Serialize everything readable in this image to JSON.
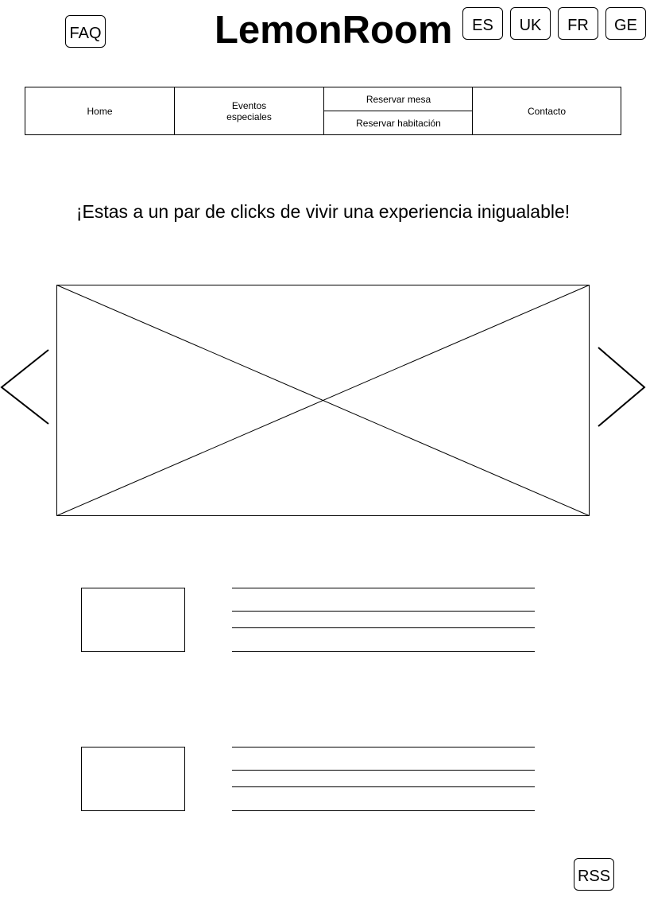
{
  "header": {
    "faq_label": "FAQ",
    "logo": "LemonRoom",
    "languages": [
      "ES",
      "UK",
      "FR",
      "GE"
    ]
  },
  "nav": {
    "home": "Home",
    "eventos_line1": "Eventos",
    "eventos_line2": "especiales",
    "reservar_mesa": "Reservar mesa",
    "reservar_habitacion": "Reservar habitación",
    "contacto": "Contacto"
  },
  "main": {
    "tagline": "¡Estas a un par de clicks de vivir una experiencia inigualable!"
  },
  "carousel": {
    "prev_icon": "chevron-left-icon",
    "next_icon": "chevron-right-icon"
  },
  "footer": {
    "rss_label": "RSS"
  }
}
